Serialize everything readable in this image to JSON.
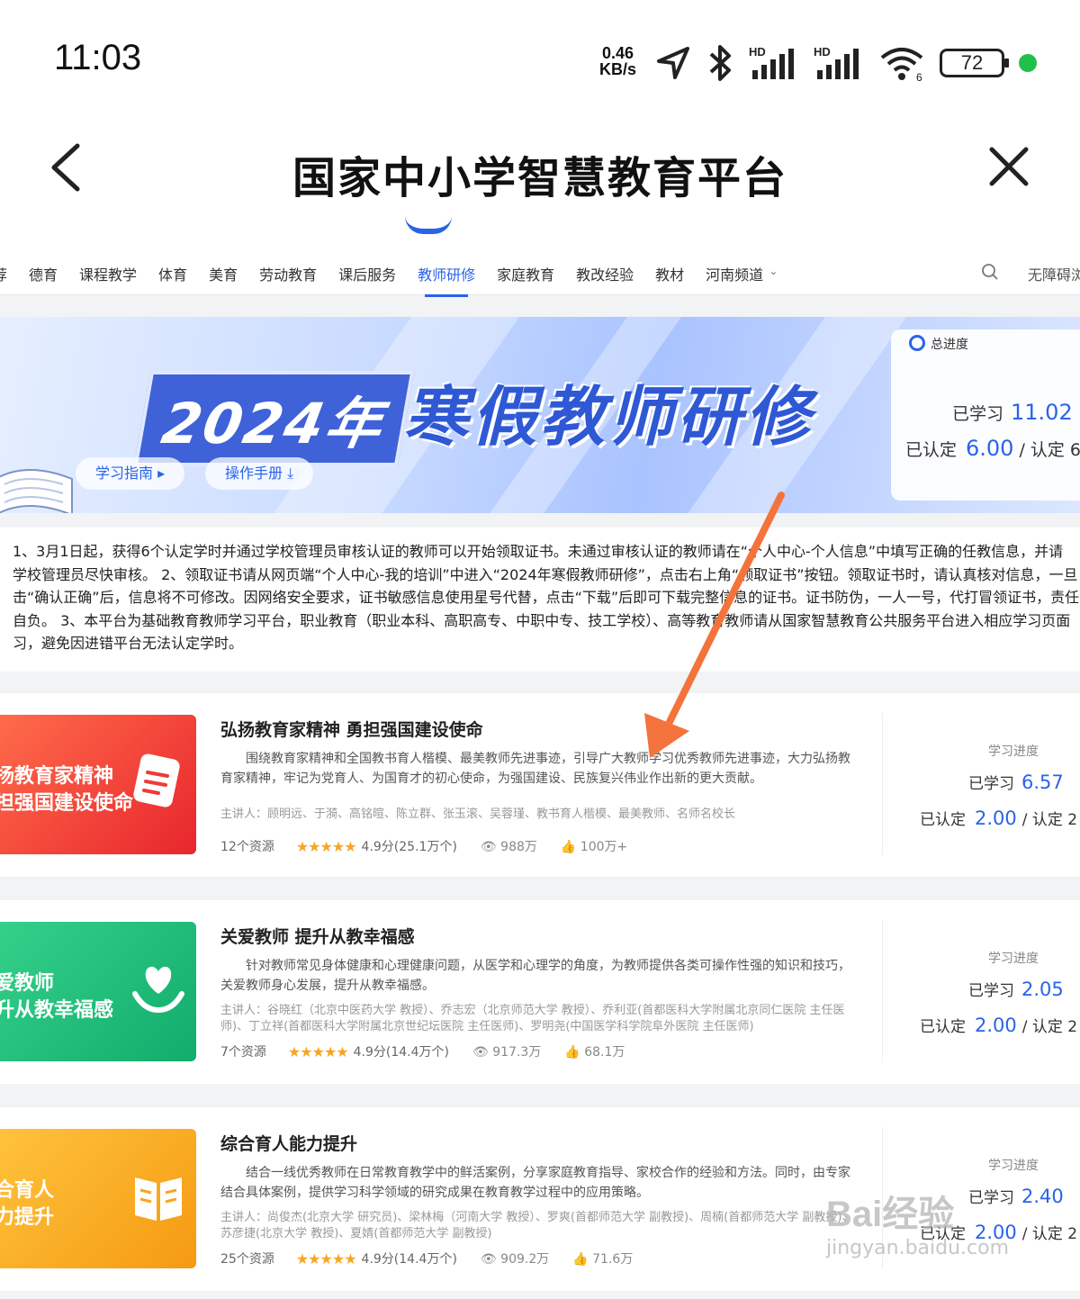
{
  "status_bar": {
    "time": "11:03",
    "net_speed_value": "0.46",
    "net_speed_unit": "KB/s",
    "battery": "72"
  },
  "header": {
    "title": "国家中小学智慧教育平台"
  },
  "nav": {
    "items": [
      "荐",
      "德育",
      "课程教学",
      "体育",
      "美育",
      "劳动教育",
      "课后服务",
      "教师研修",
      "家庭教育",
      "教改经验",
      "教材",
      "河南频道"
    ],
    "active_index": 7,
    "accessibility": "无障碍浏"
  },
  "banner": {
    "year": "2024年",
    "headline": "寒假教师研修",
    "guide_button": "学习指南 ▸",
    "manual_button": "操作手册 ⤓"
  },
  "progress": {
    "label": "总进度",
    "learned_label": "已学习",
    "learned_value": "11.02",
    "certified_label": "已认定",
    "certified_value": "6.00",
    "certified_suffix": "/ 认定 6"
  },
  "notice": {
    "lines": [
      "1、3月1日起，获得6个认定学时并通过学校管理员审核认证的教师可以开始领取证书。未通过审核认证的教师请在“个人中心-个人信息”中填写正确的任教信息，并请",
      "学校管理员尽快审核。 2、领取证书请从网页端“个人中心-我的培训”中进入“2024年寒假教师研修”，点击右上角“领取证书”按钮。领取证书时，请认真核对信息，一旦",
      "击“确认正确”后，信息将不可修改。因网络安全要求，证书敏感信息使用星号代替，点击“下载”后即可下载完整信息的证书。证书防伪，一人一号，代打冒领证书，责任",
      "自负。 3、本平台为基础教育教师学习平台，职业教育（职业本科、高职高专、中职中专、技工学校）、高等教育教师请从国家智慧教育公共服务平台进入相应学习页面",
      "习，避免因进错平台无法认定学时。"
    ]
  },
  "courses": [
    {
      "thumb_line1": "扬教育家精神",
      "thumb_line2": "担强国建设使命",
      "thumb_icon": "document-icon",
      "title": "弘扬教育家精神 勇担强国建设使命",
      "description": "围绕教育家精神和全国教书育人楷模、最美教师先进事迹，引导广大教师学习优秀教师先进事迹，大力弘扬教育家精神，牢记为党育人、为国育才的初心使命，为强国建设、民族复兴伟业作出新的更大贡献。",
      "lecturers": "主讲人：顾明远、于漪、高铭暄、陈立群、张玉滚、吴蓉瑾、教书育人楷模、最美教师、名师名校长",
      "resources": "12个资源",
      "rating": "4.9分(25.1万个)",
      "views": "988万",
      "likes": "100万+",
      "progress_title": "学习进度",
      "learned_label": "已学习",
      "learned_value": "6.57",
      "certified_label": "已认定",
      "certified_value": "2.00",
      "certified_suffix": "/ 认定 2"
    },
    {
      "thumb_line1": "爱教师",
      "thumb_line2": "升从教幸福感",
      "thumb_icon": "heart-hand-icon",
      "title": "关爱教师 提升从教幸福感",
      "description": "针对教师常见身体健康和心理健康问题，从医学和心理学的角度，为教师提供各类可操作性强的知识和技巧，关爱教师身心发展，提升从教幸福感。",
      "lecturers": "主讲人：谷晓红（北京中医药大学 教授）、乔志宏（北京师范大学 教授）、乔利亚(首都医科大学附属北京同仁医院 主任医师)、丁立祥(首都医科大学附属北京世纪坛医院 主任医师)、罗明尧(中国医学科学院阜外医院 主任医师)",
      "resources": "7个资源",
      "rating": "4.9分(14.4万个)",
      "views": "917.3万",
      "likes": "68.1万",
      "progress_title": "学习进度",
      "learned_label": "已学习",
      "learned_value": "2.05",
      "certified_label": "已认定",
      "certified_value": "2.00",
      "certified_suffix": "/ 认定 2"
    },
    {
      "thumb_line1": "合育人",
      "thumb_line2": "力提升",
      "thumb_icon": "book-icon",
      "title": "综合育人能力提升",
      "description": "结合一线优秀教师在日常教育教学中的鲜活案例，分享家庭教育指导、家校合作的经验和方法。同时，由专家结合具体案例，提供学习科学领域的研究成果在教育教学过程中的应用策略。",
      "lecturers": "主讲人：尚俊杰(北京大学 研究员)、梁林梅（河南大学 教授）、罗爽(首都师范大学 副教授)、周楠(首都师范大学 副教授)、苏彦捷(北京大学 教授)、夏婧(首都师范大学 副教授)",
      "resources": "25个资源",
      "rating": "4.9分(14.4万个)",
      "views": "909.2万",
      "likes": "71.6万",
      "progress_title": "学习进度",
      "learned_label": "已学习",
      "learned_value": "2.40",
      "certified_label": "已认定",
      "certified_value": "2.00",
      "certified_suffix": "/ 认定 2"
    }
  ],
  "watermark": {
    "brand": "Bai经验",
    "url": "jingyan.baidu.com"
  },
  "colors": {
    "accent": "#2a63e8",
    "card1": "#ef3b35",
    "card2": "#17b979",
    "card3": "#f8a51d",
    "arrow": "#f4733d"
  }
}
